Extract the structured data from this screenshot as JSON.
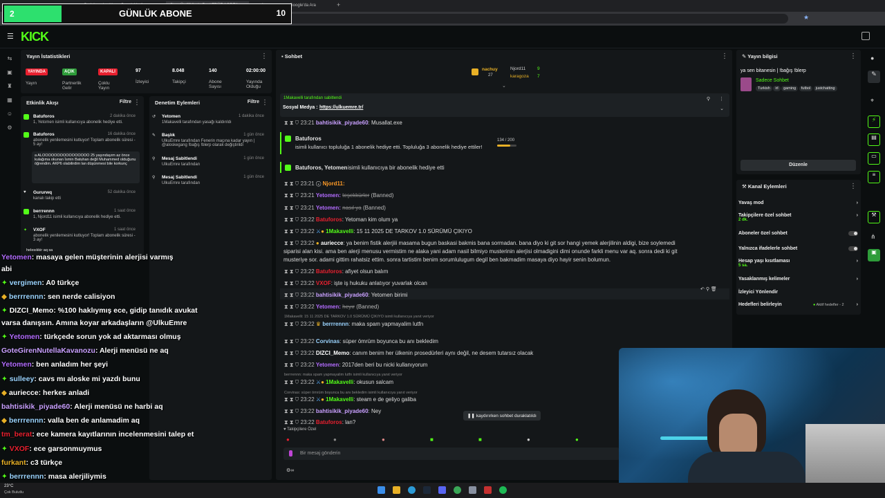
{
  "browser": {
    "tabs": [
      "Gerici yardım kleo - Google'da Ara",
      "Stream - Kick",
      "Üç Kırlarda Beni TRÜZ AGREA",
      "site memnunu - Google'da Ara"
    ],
    "url": "dashboard.kick.com/stream"
  },
  "sub_overlay": {
    "count": "2",
    "label": "GÜNLÜK ABONE",
    "goal": "10"
  },
  "header": {
    "logo": "KICK"
  },
  "stats_panel": {
    "title": "Yayın İstatistikleri",
    "pills": [
      {
        "text": "YAYINDA",
        "sub": "Yayın",
        "color": "#e8202f"
      },
      {
        "text": "AÇIK",
        "sub": "Partnerlik Gelir",
        "color": "#2e9c3a"
      },
      {
        "text": "KAPALI",
        "sub": "Çoklu Yayın",
        "color": "#e8202f"
      }
    ],
    "metrics": [
      {
        "value": "97",
        "label": "İzleyici"
      },
      {
        "value": "8.048",
        "label": "Takipçi"
      },
      {
        "value": "140",
        "label": "Abone Sayısı"
      },
      {
        "value": "02:00:00",
        "label": "Yayında Olduğu"
      }
    ]
  },
  "activity_feed": {
    "title": "Etkinlik Akışı",
    "filter": "Filtre",
    "items": [
      {
        "user": "Batuforos",
        "text": "1, Yetomen isimli kullanıcıya abonelik hediye etti.",
        "time": "2 dakika önce"
      },
      {
        "user": "Batuforos",
        "text": "abonelik yenilemesini kutluyor! Toplam abonelik süresi - 5 ay!",
        "time": "16 dakika önce"
      },
      {
        "user": "",
        "text": "a ALOOOOOOOOOOOOOOOO 25 yaşındayım az önce kulağıma okunan İsmin Batuhan değil Muhammed olduğunu öğrendim. AKP6 olabilirdim lan düşünmesi bile korkunç",
        "time": ""
      },
      {
        "user": "Gururwq",
        "text": "kanalı takip etti",
        "time": "52 dakika önce"
      },
      {
        "user": "berrrennn",
        "text": "1, Njord11 isimli kullanıcıya abonelik hediye etti.",
        "time": "1 saat önce"
      },
      {
        "user": "VXOF",
        "text": "abonelik yenilemesini kutluyor! Toplam abonelik süresi - 3 ay!",
        "time": "1 saat önce"
      },
      {
        "user": "",
        "text": "helesıkkir aq sa",
        "time": ""
      }
    ]
  },
  "moderation": {
    "title": "Denetim Eylemleri",
    "filter": "Filtre",
    "items": [
      {
        "user": "Yetomen",
        "text": "1Makavelli tarafından yasağı kaldırıldı",
        "time": "1 dakika önce"
      },
      {
        "user": "Başlık",
        "text": "UlkuEmre tarafından Fenerin maçına kadar yayın | @aloskegang !bağış !blerp olarak değiştirildi",
        "time": "1 gün önce"
      },
      {
        "user": "Mesaj Sabitlendi",
        "text": "UlkuEmre tarafından",
        "time": "1 gün önce"
      },
      {
        "user": "Mesaj Sabitlendi",
        "text": "UlkuEmre tarafından",
        "time": "1 gün önce"
      }
    ]
  },
  "chat": {
    "title": "Sohbet",
    "top_gifters": [
      {
        "name": "nachuy",
        "count": "27"
      },
      {
        "name": "Njord11",
        "count": "9"
      },
      {
        "name": "karagoza",
        "count": "7"
      }
    ],
    "pinned": {
      "by": "1Makavelli tarafından sabitlendi",
      "text": "Sosyal Medya :",
      "link": "https://ulkuemre.tr/"
    },
    "messages": [
      {
        "time": "23:21",
        "user": "bahtisikik_piyade60",
        "color": "#c9a0ff",
        "text": "Musallat.exe"
      },
      {
        "time": "",
        "user": "Batuforos",
        "color": "#fff",
        "text": "isimli kullanıcı topluluğa 1 abonelik hediye etti. Topluluğa 3 abonelik hediye ettiler!"
      },
      {
        "time": "",
        "user": "Batuforos, Yetomen",
        "color": "#fff",
        "text": "isimli kullanıcıya bir abonelik hediye etti"
      },
      {
        "time": "23:21",
        "user": "Njord11:",
        "color": "#ff9b26",
        "text": ""
      },
      {
        "time": "23:21",
        "user": "Yetomen:",
        "color": "#b36cff",
        "text": "teşekkürler",
        "banned": "(Banned)"
      },
      {
        "time": "23:21",
        "user": "Yetomen:",
        "color": "#b36cff",
        "text": "nasıl ya",
        "banned": "(Banned)"
      },
      {
        "time": "23:22",
        "user": "Batuforos",
        "color": "#e8202f",
        "text": ": Yetoman kim olum ya"
      },
      {
        "time": "23:22",
        "user": "1Makavelli",
        "color": "#53fc18",
        "text": ": 15 11 2025 DE TARKOV 1.0 SÜRÜMÜ ÇIKIYO"
      },
      {
        "time": "23:22",
        "user": "auriecce",
        "color": "#fff",
        "text": ": ya benim fistik alerjiii masama bugun baskasi bakmis bana sormadan. bana diyo ki git sor hangi yemek alerjilinin aldigi, bize soylemedi"
      },
      {
        "time": "",
        "user": "",
        "color": "#fff",
        "text": "siparisi alan kisi. ama ben alerji menusu vermistim ne alaka yani adam nasil bilmiyo musterinin alerjisi olmadigini dimi onunde farkli menu var aq. sonra dedi ki git"
      },
      {
        "time": "",
        "user": "",
        "color": "#fff",
        "text": "musteriye sor. adami gittim rahatsiz ettim. sonra tartistim benim sorumlulugum degil ben bakmadim masaya diyo hayir senin bolumun."
      },
      {
        "time": "23:22",
        "user": "Batuforos",
        "color": "#e8202f",
        "text": ": afiyet olsun balım"
      },
      {
        "time": "23:22",
        "user": "VXOF",
        "color": "#e8202f",
        "text": ": işte iş hukuku anlatıyor yuvarlak olcan"
      },
      {
        "time": "23:22",
        "user": "bahtisikik_piyade60",
        "color": "#c9a0ff",
        "text": ": Yetomen birimi"
      },
      {
        "time": "23:22",
        "user": "Yetomen:",
        "color": "#b36cff",
        "text": "heyır",
        "banned": "(Banned)"
      },
      {
        "time": "",
        "user": "",
        "color": "#888",
        "text": "1Makavelli: 15 11 2025 DE TARKOV 1.0 SÜRÜMÜ ÇIKIYO isimli kullanıcıya yanıt veriyor"
      },
      {
        "time": "23:22",
        "user": "berrrennn",
        "color": "#9bd4ff",
        "text": ": maka spam yapmayalim lutfn"
      },
      {
        "time": "23:22",
        "user": "Corvinas",
        "color": "#9bd4ff",
        "text": ": süper ömrüm boyunca bu anı bekledim"
      },
      {
        "time": "23:22",
        "user": "DIZCI_Memo",
        "color": "#fff",
        "text": ": canım benim her ülkenin prosedürleri aynı değil, ne desem tutarsız olacak"
      },
      {
        "time": "23:22",
        "user": "Yetomen",
        "color": "#b36cff",
        "text": ": 2017den beri bu nicki kullanıyorum"
      },
      {
        "time": "",
        "user": "",
        "color": "#888",
        "text": "berrrennn: maka spam yapmayalim lutfn isimli kullanıcıya yanıt veriyor"
      },
      {
        "time": "23:22",
        "user": "1Makavelli",
        "color": "#53fc18",
        "text": ": okusun salcam"
      },
      {
        "time": "",
        "user": "",
        "color": "#888",
        "text": "Corvinas: süper ömrüm boyunca bu anı bekledim isimli kullanıcıya yanıt veriyor"
      },
      {
        "time": "23:22",
        "user": "1Makavelli",
        "color": "#53fc18",
        "text": ": steam e de geliyo galiba"
      },
      {
        "time": "23:22",
        "user": "bahtisikik_piyade60",
        "color": "#c9a0ff",
        "text": ": Ney"
      },
      {
        "time": "23:22",
        "user": "Batuforos",
        "color": "#e8202f",
        "text": ": lan?"
      }
    ],
    "gift_progress": {
      "value": "134",
      "max": "200",
      "fraction": 0.67
    },
    "paused_label": "kaydırırken sohbet duraklatıldı",
    "follower_label": "Takipçilere Özel",
    "input_placeholder": "Bir mesaj gönderin"
  },
  "stream_info": {
    "title": "Yayın bilgisi",
    "stream_title": "ya sen bitanesin | !bağış !blerp",
    "chat_mode": "Sadece Sohbet",
    "tags": [
      "Turkish",
      "irl",
      "gaming",
      "futbol",
      "justchatting"
    ],
    "edit_button": "Düzenle"
  },
  "channel_actions": {
    "title": "Kanal Eylemleri",
    "items": [
      {
        "label": "Yavaş mod",
        "sub": "",
        "control": "chevron"
      },
      {
        "label": "Takipçilere özel sohbet",
        "sub": "2 dk.",
        "control": "chevron"
      },
      {
        "label": "Aboneler özel sohbet",
        "sub": "",
        "control": "toggle"
      },
      {
        "label": "Yalnızca ifadelerle sohbet",
        "sub": "",
        "control": "toggle"
      },
      {
        "label": "Hesap yaşı kısıtlaması",
        "sub": "5 sa.",
        "control": "chevron"
      },
      {
        "label": "Yasaklanmış kelimeler",
        "sub": "",
        "control": "chevron"
      },
      {
        "label": "İzleyici Yönlendir",
        "sub": "",
        "control": "none"
      },
      {
        "label": "Hedefleri belirleyin",
        "sub": "",
        "control": "chevron",
        "extra": "Aktif hedefler - 2"
      }
    ]
  },
  "stream_overlay_chat": [
    {
      "user": "Yetomen",
      "color": "#b36cff",
      "text": ": masaya gelen müşterinin alerjisi varmış"
    },
    {
      "user": "",
      "color": "#fff",
      "text": "abi"
    },
    {
      "user": "vergimen",
      "color": "#9bd4ff",
      "text": ": A0 türkçe"
    },
    {
      "user": "berrrennn",
      "color": "#9bd4ff",
      "text": ": sen nerde calisiyon"
    },
    {
      "user": "DIZCI_Memo",
      "color": "#fff",
      "text": ": %100 haklıymış ece, gidip tanıdık avukat"
    },
    {
      "user": "",
      "color": "#fff",
      "text": "varsa danışsın. Amına koyar arkadaşların @UlkuEmre"
    },
    {
      "user": "Yetomen",
      "color": "#b36cff",
      "text": ": türkçede sorun yok ad aktarması olmuş"
    },
    {
      "user": "GoteGirenNutellaKavanozu",
      "color": "#c9a0ff",
      "text": ": Alerji menüsü ne aq"
    },
    {
      "user": "Yetomen",
      "color": "#b36cff",
      "text": ": ben anladım her şeyi"
    },
    {
      "user": "sulleey",
      "color": "#9bd4ff",
      "text": ": cavs mı aloske mi yazdı bunu"
    },
    {
      "user": "auriecce",
      "color": "#fff",
      "text": ": herkes anladi"
    },
    {
      "user": "bahtisikik_piyade60",
      "color": "#c9a0ff",
      "text": ": Alerji menüsü ne harbi aq"
    },
    {
      "user": "berrrennn",
      "color": "#9bd4ff",
      "text": ": valla ben de anlamadim aq"
    },
    {
      "user": "tm_berat",
      "color": "#e8202f",
      "text": ": ece kamera kayıtlarının incelenmesini talep et"
    },
    {
      "user": "VXOF",
      "color": "#e8202f",
      "text": ": ece garsonmuymus"
    },
    {
      "user": "furkant",
      "color": "#e8b026",
      "text": ": c3 türkçe"
    },
    {
      "user": "berrrennn",
      "color": "#9bd4ff",
      "text": ": masa alerjiliymis"
    }
  ],
  "taskbar": {
    "weather_temp": "23°C",
    "weather_desc": "Çok Bulutlu"
  }
}
